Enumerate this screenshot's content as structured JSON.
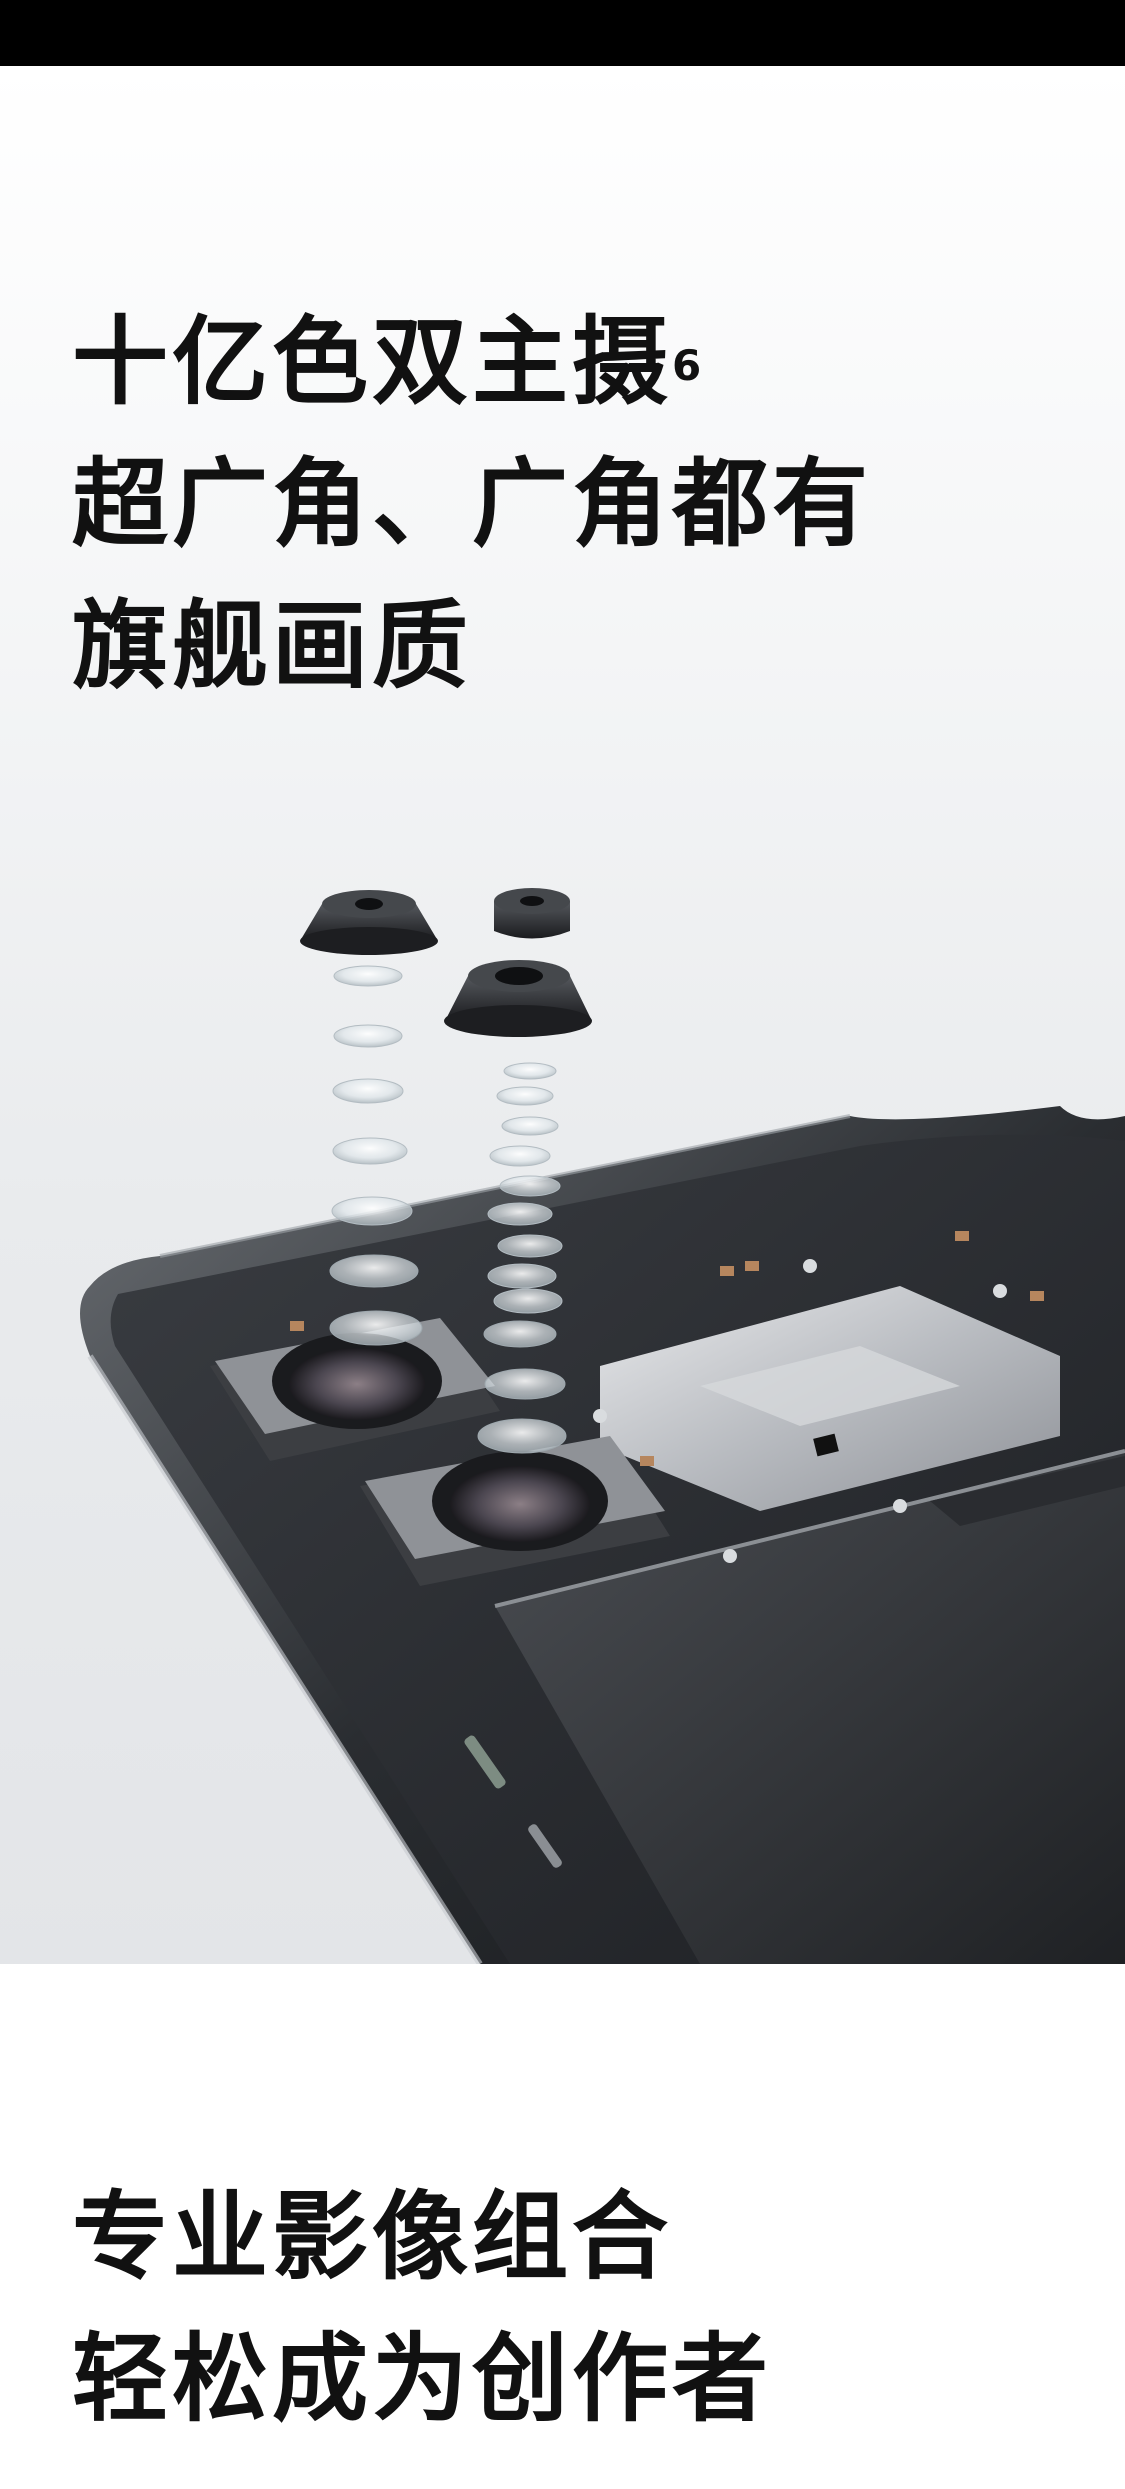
{
  "hero": {
    "headline": {
      "line1": "十亿色双主摄",
      "line1_sup": "6",
      "line2": "超广角、广角都有",
      "line3": "旗舰画质"
    },
    "image": "exploded-phone-dual-camera-illustration"
  },
  "footer": {
    "headline": {
      "line1": "专业影像组合",
      "line2": "轻松成为创作者"
    }
  }
}
